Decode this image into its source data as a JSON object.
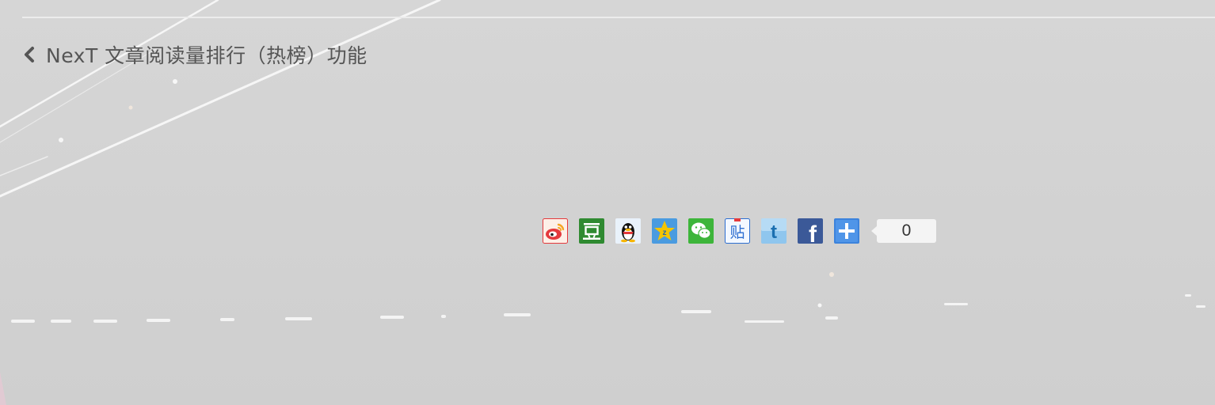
{
  "post_nav": {
    "prev_title": "NexT 文章阅读量排行（热榜）功能"
  },
  "share": {
    "buttons": [
      {
        "name": "weibo",
        "glyph": "微",
        "color": "#e4393c"
      },
      {
        "name": "douban",
        "glyph": "豆",
        "color": "#2f8a31"
      },
      {
        "name": "qq",
        "glyph": "Q",
        "color": "#3a8ad8"
      },
      {
        "name": "qzone",
        "glyph": "z",
        "color": "#f0b400"
      },
      {
        "name": "wechat",
        "glyph": "微",
        "color": "#3db53a"
      },
      {
        "name": "tieba",
        "glyph": "贴",
        "color": "#2d6ed0"
      },
      {
        "name": "twitter",
        "glyph": "t",
        "color": "#55acee"
      },
      {
        "name": "facebook",
        "glyph": "f",
        "color": "#3b5998"
      },
      {
        "name": "more",
        "glyph": "+",
        "color": "#3c83dc"
      }
    ],
    "count": "0"
  }
}
